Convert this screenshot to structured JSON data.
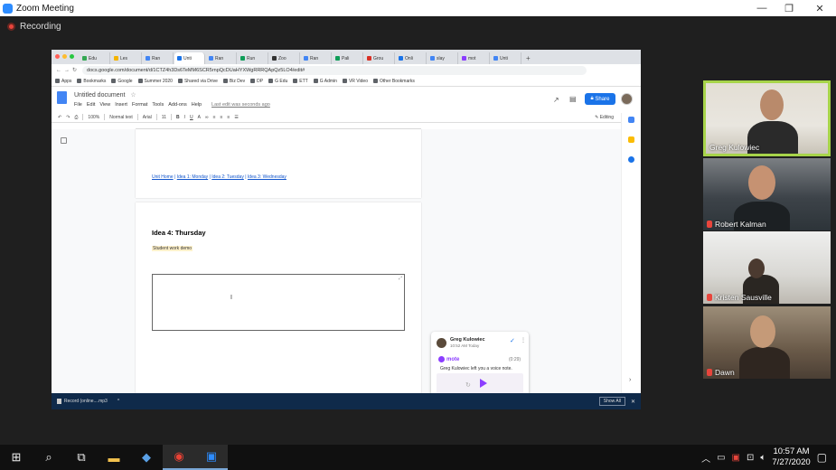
{
  "zoom": {
    "title": "Zoom Meeting",
    "recording": "Recording",
    "controls": {
      "minimize": "—",
      "restore": "❐",
      "close": "✕"
    }
  },
  "browser": {
    "tabs": [
      "Edu",
      "Les",
      "Ran",
      "Unti",
      "Ran",
      "Run",
      "Zoo",
      "Ran",
      "Pali",
      "Grou",
      "Onli",
      "slay",
      "mot",
      "Unti"
    ],
    "active_tab_index": 3,
    "url": "docs.google.com/document/d/1CTZ4h3Ds6TeMM6SCR5rnpQcDUaHYXWgRRRQApQz5LO4/edit#",
    "bookmarks": [
      "Apps",
      "Bookmarks",
      "Google",
      "Summer 2020",
      "Shared via Drive",
      "Biz Dev",
      "DP",
      "G Edu",
      "ETT",
      "G Admin",
      "VR Video",
      "Other Bookmarks"
    ]
  },
  "docs": {
    "title": "Untitled document",
    "menu": [
      "File",
      "Edit",
      "View",
      "Insert",
      "Format",
      "Tools",
      "Add-ons",
      "Help"
    ],
    "last_edit": "Last edit was seconds ago",
    "share_label": "Share",
    "toolbar": {
      "zoom": "100%",
      "style": "Normal text",
      "font": "Arial",
      "size": "11",
      "mode": "Editing"
    },
    "page1_links": [
      "Unit Home",
      "Idea 1: Monday",
      "Idea 2: Tuesday",
      "Idea 3: Wednesday"
    ],
    "link_separator": " | ",
    "page2_heading": "Idea 4: Thursday",
    "page2_highlight": "Student work demo"
  },
  "comment": {
    "author": "Greg Kulowiec",
    "time": "10:52 AM Today",
    "app": "mote",
    "duration": "(0:29)",
    "text": "Greg Kulowiec left you a voice note."
  },
  "download": {
    "file": "Record (online....mp3",
    "show_all": "Show All"
  },
  "participants": [
    {
      "name": "Greg Kulowiec",
      "muted": false,
      "active_speaker": true
    },
    {
      "name": "Robert Kalman",
      "muted": true
    },
    {
      "name": "Kristen Sausville",
      "muted": true
    },
    {
      "name": "Dawn",
      "muted": true
    }
  ],
  "taskbar": {
    "time": "10:57 AM",
    "date": "7/27/2020"
  },
  "colors": {
    "zoom_blue": "#2d8cff",
    "docs_blue": "#1a73e8",
    "active_speaker": "#a7d44a",
    "mote_purple": "#8b3dff",
    "mute_red": "#e8453c"
  }
}
